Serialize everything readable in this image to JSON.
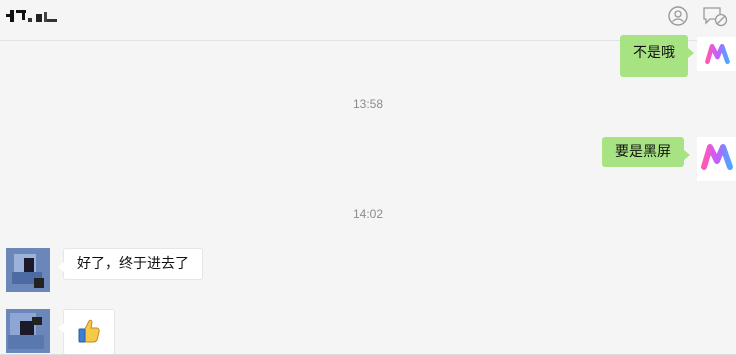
{
  "header": {
    "title_glyph": "chat-name-redacted",
    "icons": [
      "user-settings-icon",
      "mute-chat-icon"
    ]
  },
  "messages": [
    {
      "from": "me",
      "text": "不是哦"
    },
    {
      "type": "timestamp",
      "text": "13:58"
    },
    {
      "from": "me",
      "text": "要是黑屏"
    },
    {
      "type": "timestamp",
      "text": "14:02"
    },
    {
      "from": "other",
      "text": "好了，终于进去了"
    },
    {
      "from": "other",
      "emoji": "thumbs-up-icon"
    }
  ],
  "colors": {
    "background": "#f5f5f5",
    "my_bubble": "#a7e283",
    "other_bubble": "#ffffff",
    "timestamp": "#8c8c8c"
  }
}
